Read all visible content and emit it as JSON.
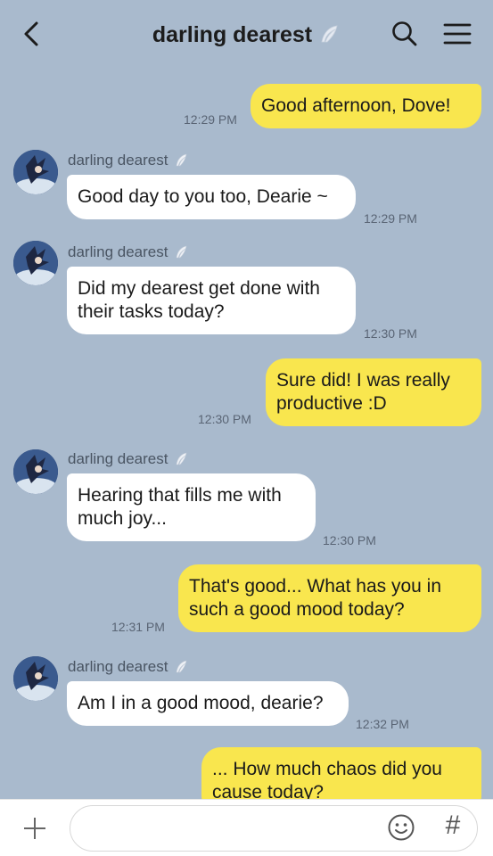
{
  "header": {
    "title": "darling dearest",
    "back_icon": "chevron-left-icon",
    "search_icon": "search-icon",
    "menu_icon": "hamburger-menu-icon",
    "badge_icon": "feather-icon"
  },
  "colors": {
    "background": "#a9bacd",
    "outgoing_bubble": "#f9e64e",
    "incoming_bubble": "#ffffff"
  },
  "messages": [
    {
      "direction": "out",
      "text": "Good afternoon, Dove!",
      "time": "12:29 PM"
    },
    {
      "direction": "in",
      "sender": "darling dearest",
      "text": "Good day to you too, Dearie ~",
      "time": "12:29 PM"
    },
    {
      "direction": "in",
      "sender": "darling dearest",
      "text": "Did my dearest get done with\ntheir tasks today?",
      "time": "12:30 PM"
    },
    {
      "direction": "out",
      "text": "Sure did! I was really\nproductive :D",
      "time": "12:30 PM"
    },
    {
      "direction": "in",
      "sender": "darling dearest",
      "text": "Hearing that fills me with\nmuch joy...",
      "time": "12:30 PM"
    },
    {
      "direction": "out",
      "text": "That's good... What has you in\nsuch a good mood today?",
      "time": "12:31 PM"
    },
    {
      "direction": "in",
      "sender": "darling dearest",
      "text": "Am I in a good mood, dearie?",
      "time": "12:32 PM"
    },
    {
      "direction": "out",
      "text": "... How much chaos did you\ncause today?",
      "time": ""
    }
  ],
  "input_bar": {
    "placeholder": "",
    "plus_icon": "plus-icon",
    "emoji_icon": "emoji-icon",
    "hash_label": "#"
  }
}
